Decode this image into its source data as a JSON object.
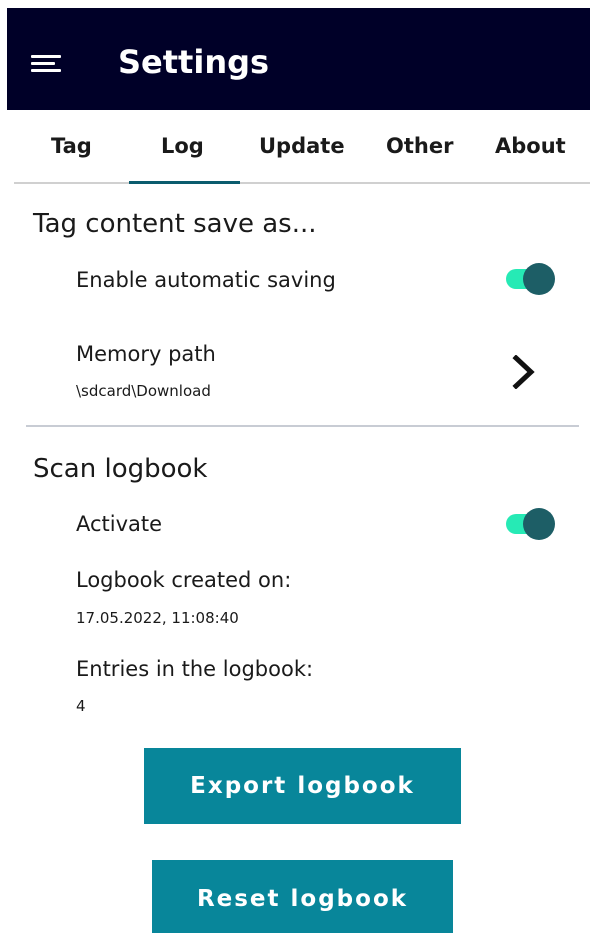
{
  "app_bar": {
    "title": "Settings",
    "menu_icon": "hamburger-menu-icon"
  },
  "tabs": [
    {
      "label": "Tag"
    },
    {
      "label": "Log",
      "active": true
    },
    {
      "label": "Update"
    },
    {
      "label": "Other"
    },
    {
      "label": "About"
    }
  ],
  "tag_section": {
    "title": "Tag content save as...",
    "auto_save": {
      "label": "Enable automatic saving",
      "enabled": true
    },
    "memory_path": {
      "label": "Memory path",
      "value": "\\sdcard\\Download",
      "icon": "chevron-right-icon"
    }
  },
  "logbook_section": {
    "title": "Scan logbook",
    "activate": {
      "label": "Activate",
      "enabled": true
    },
    "created_on": {
      "label": "Logbook created on:",
      "value": "17.05.2022, 11:08:40"
    },
    "entries": {
      "label": "Entries in the logbook:",
      "value": "4"
    }
  },
  "buttons": {
    "export_label": "Export logbook",
    "reset_label": "Reset logbook"
  },
  "colors": {
    "app_bar": "#000028",
    "accent": "#08869a",
    "toggle_track": "#00e6a8",
    "toggle_thumb": "#1d5e66",
    "tab_indicator": "#0a5c6e"
  }
}
